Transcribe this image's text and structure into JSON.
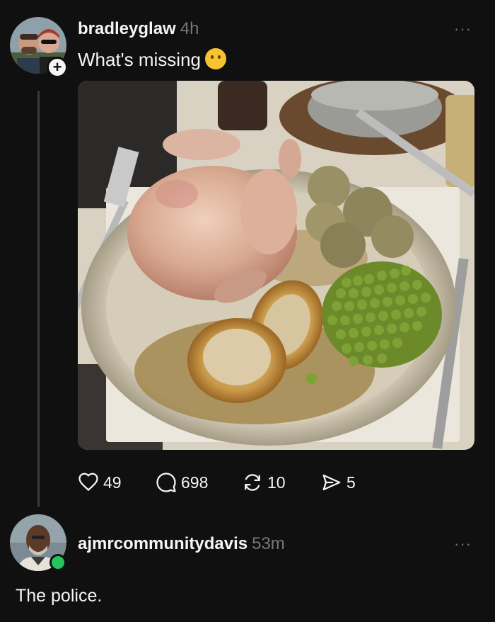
{
  "post": {
    "username": "bradleyglaw",
    "time": "4h",
    "text": "What's missing",
    "emoji": "thinking-face",
    "follow_symbol": "+",
    "more_symbol": "···",
    "actions": {
      "likes": "49",
      "comments": "698",
      "reposts": "10",
      "shares": "5"
    }
  },
  "reply": {
    "username": "ajmrcommunitydavis",
    "time": "53m",
    "text": "The police.",
    "more_symbol": "···"
  },
  "colors": {
    "background": "#101010",
    "text": "#f3f5f7",
    "muted": "#777777",
    "online": "#26c55b"
  }
}
